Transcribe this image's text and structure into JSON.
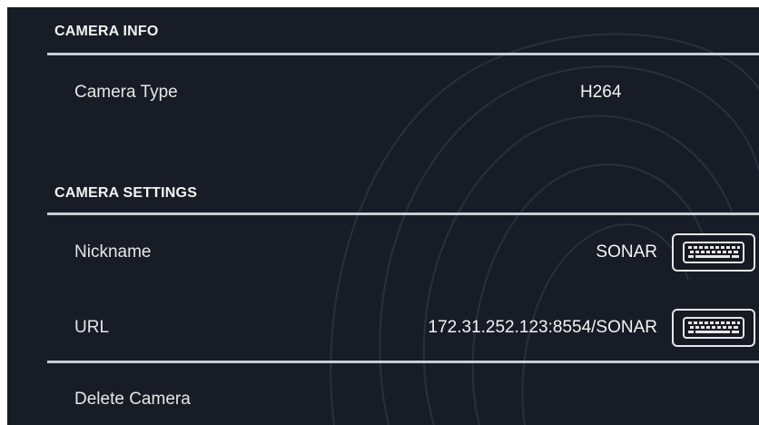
{
  "camera_info": {
    "header": "CAMERA INFO",
    "camera_type_label": "Camera Type",
    "camera_type_value": "H264"
  },
  "camera_settings": {
    "header": "CAMERA SETTINGS",
    "nickname_label": "Nickname",
    "nickname_value": "SONAR",
    "url_label": "URL",
    "url_value": "172.31.252.123:8554/SONAR",
    "delete_label": "Delete Camera"
  },
  "icons": {
    "edit_nickname": "keyboard-icon",
    "edit_url": "keyboard-icon"
  },
  "colors": {
    "background": "#181c26",
    "text": "#e6e6e6",
    "divider": "#c9ccd2"
  }
}
